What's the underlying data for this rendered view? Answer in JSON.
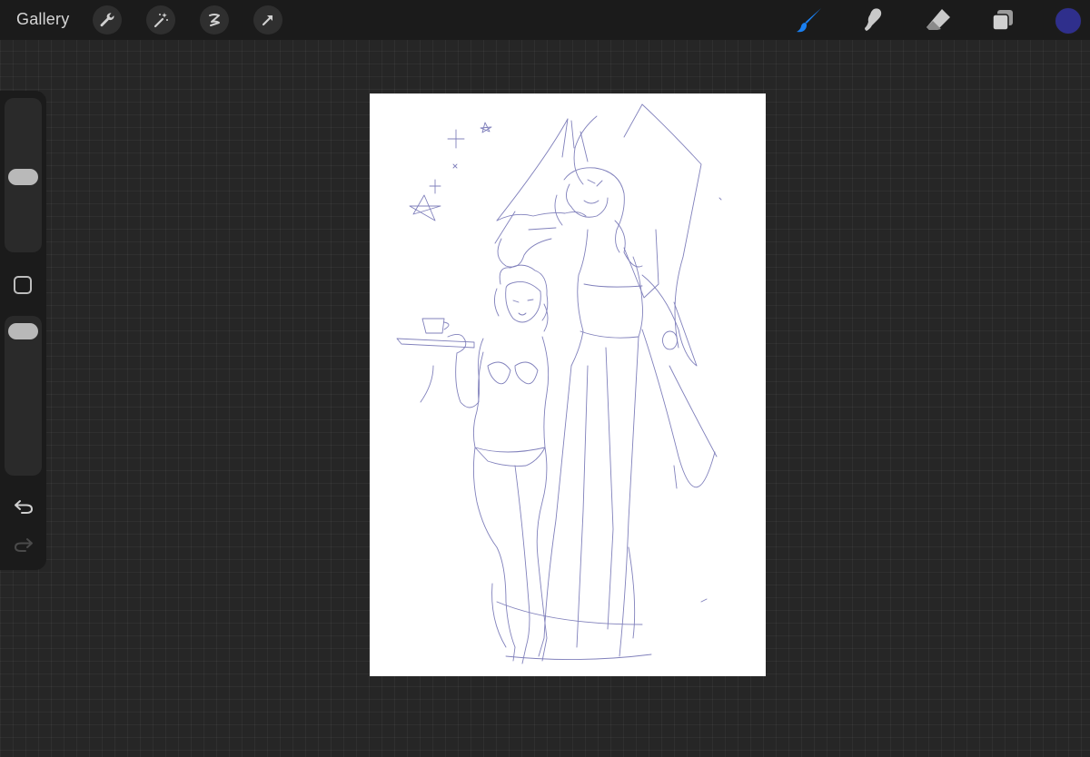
{
  "topbar": {
    "gallery_label": "Gallery",
    "left_tools": [
      "wrench-icon",
      "magic-wand-icon",
      "selection-icon",
      "transform-arrow-icon"
    ],
    "right_tools": [
      "brush-icon",
      "smudge-icon",
      "eraser-icon",
      "layers-icon"
    ],
    "active_tool": "brush",
    "current_color": "#2f2f8c"
  },
  "sidebar": {
    "brush_size_level": 0.2,
    "opacity_level": 0.07,
    "icons": [
      "undo-icon",
      "redo-icon"
    ]
  },
  "canvas": {
    "content": "pencil-sketch-artwork",
    "stroke_color": "#6b6bb0"
  },
  "colors": {
    "accent_blue": "#1a7ff0",
    "ui_dark": "#1b1b1b",
    "background": "#262626"
  }
}
